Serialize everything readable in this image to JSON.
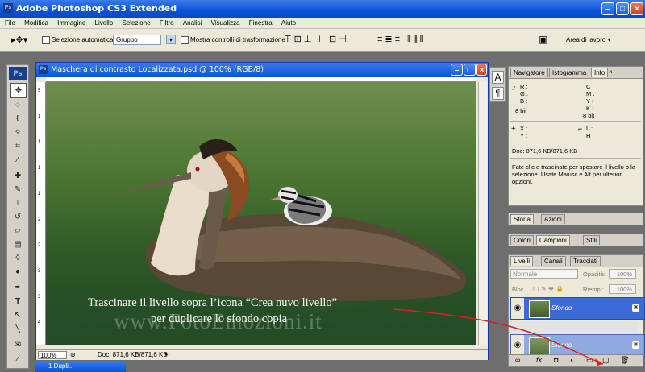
{
  "app": {
    "title": "Adobe Photoshop CS3 Extended"
  },
  "menu": [
    "File",
    "Modifica",
    "Immagine",
    "Livello",
    "Selezione",
    "Filtro",
    "Analisi",
    "Visualizza",
    "Finestra",
    "Aiuto"
  ],
  "options": {
    "auto_select_label": "Selezione automatica:",
    "auto_select_value": "Gruppo",
    "transform_label": "Mostra controlli di trasformazione",
    "workspace_label": "Area di lavoro"
  },
  "document": {
    "title": "Maschera di contrasto Localizzata.psd @ 100% (RGB/8)",
    "overlay_line1": "Trascinare il livello sopra l’icona “Crea nuvo livello”",
    "overlay_line2": "per duplicare lo sfondo copia",
    "watermark": "www.FotoEmozioni.it",
    "zoom": "100%",
    "doc_size": "Doc: 871,6 KB/871,6 KB",
    "ruler_ticks_v": [
      "5",
      "1",
      "1",
      "1",
      "1",
      "2",
      "2",
      "3",
      "3",
      "4"
    ]
  },
  "info_panel": {
    "tabs": [
      "Navigatore",
      "Istogramma",
      "Info"
    ],
    "rgb": [
      "R :",
      "G :",
      "B :"
    ],
    "cmyk": [
      "C :",
      "M :",
      "Y :",
      "K :"
    ],
    "bit1": "8 bit",
    "bit2": "8 bit",
    "xy": [
      "X :",
      "Y :"
    ],
    "lh": [
      "L :",
      "H :"
    ],
    "doc": "Doc: 871,6 KB/871,6 KB",
    "hint": "Fate clic e trascinate per spostare il livello o la selezione. Usate Maiusc e Alt per ulteriori opzioni."
  },
  "history_panel": {
    "tabs": [
      "Storia",
      "Azioni"
    ]
  },
  "swatch_panel": {
    "tabs": [
      "Colori",
      "Campioni",
      "Stili"
    ]
  },
  "layers_panel": {
    "tabs": [
      "Livelli",
      "Canali",
      "Tracciati"
    ],
    "blend_mode": "Normale",
    "opacity_label": "Opacità:",
    "opacity_value": "100%",
    "lock_label": "Bloc.:",
    "fill_label": "Riemp.:",
    "fill_value": "100%",
    "layers": [
      {
        "name": "Sfondo"
      },
      {
        "name": "Sfondo"
      }
    ]
  },
  "taskbar": {
    "label": "1 Dupli..."
  },
  "colors": {
    "titlebar": "#0a52d8",
    "arrow": "#d92020",
    "highlight": "#3a6bd6"
  }
}
